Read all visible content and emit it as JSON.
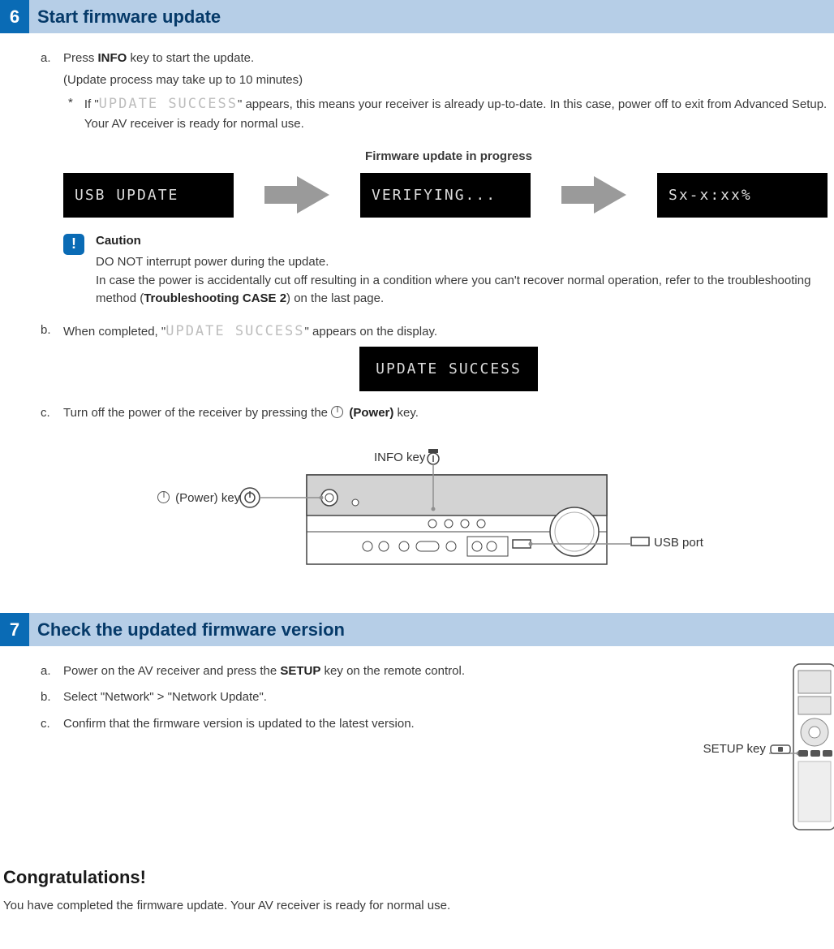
{
  "section6": {
    "num": "6",
    "title": "Start firmware update",
    "a": {
      "marker": "a.",
      "line1_pre": "Press ",
      "line1_bold": "INFO",
      "line1_post": " key to start the update.",
      "line2": "(Update process may take up to 10 minutes)",
      "ast_marker": "*",
      "ast_pre": "If \"",
      "ast_lcd": "UPDATE SUCCESS",
      "ast_post": "\" appears, this means your receiver is already up-to-date. In this case, power off to exit from Advanced Setup. Your AV receiver is ready for normal use."
    },
    "progress_title": "Firmware update in progress",
    "lcd1": "USB UPDATE",
    "lcd2": "VERIFYING...",
    "lcd3": "Sx-x:xx%",
    "caution": {
      "badge": "!",
      "title": "Caution",
      "line1": "DO NOT interrupt power during the update.",
      "line2_pre": "In case the power is accidentally cut off resulting in a condition where you can't recover normal operation, refer to the troubleshooting method (",
      "line2_bold": "Troubleshooting CASE 2",
      "line2_post": ") on the last page."
    },
    "b": {
      "marker": "b.",
      "pre": "When completed, \"",
      "lcd": "UPDATE SUCCESS",
      "post": "\" appears on the display."
    },
    "lcd_success": "UPDATE SUCCESS",
    "c": {
      "marker": "c.",
      "pre": "Turn off the power of the receiver by pressing the ",
      "bold": "(Power)",
      "post": " key."
    },
    "labels": {
      "info_key": "INFO key",
      "power_key": "(Power) key",
      "usb_port": "USB port"
    }
  },
  "section7": {
    "num": "7",
    "title": "Check the updated firmware version",
    "a": {
      "marker": "a.",
      "pre": "Power on the AV receiver and press the ",
      "bold": "SETUP",
      "post": " key on the remote control."
    },
    "b": {
      "marker": "b.",
      "text": "Select \"Network\" > \"Network Update\"."
    },
    "c": {
      "marker": "c.",
      "text": "Confirm that the firmware version is updated to the latest version."
    },
    "setup_label": "SETUP key"
  },
  "congrats": {
    "title": "Congratulations!",
    "text": "You have completed the firmware update. Your AV receiver is ready for normal use."
  }
}
